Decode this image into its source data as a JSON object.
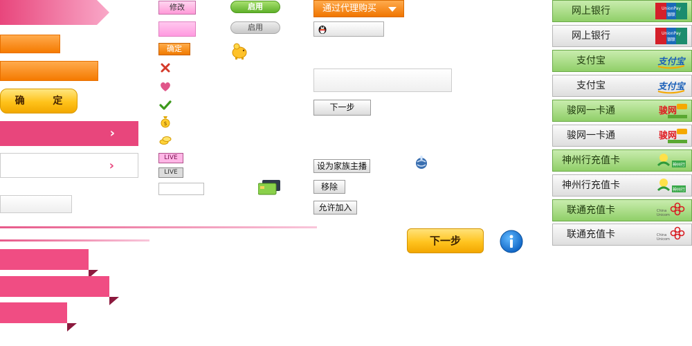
{
  "buttons": {
    "confirm_gold": "确 定",
    "edit_pink": "修改",
    "enable_green": "启用",
    "enable_grey": "启用",
    "confirm_orange": "确定",
    "live_pink": "LIVE",
    "live_grey": "LIVE",
    "agent_buy": "通过代理购买",
    "next_small": "下一步",
    "set_family_host": "设为家族主播",
    "remove": "移除",
    "allow_join": "允许加入",
    "next_gold": "下一步"
  },
  "payment_methods": [
    {
      "label": "网上银行",
      "style": "green",
      "logo": "unionpay-icon",
      "logo_text": "UnionPay 银联"
    },
    {
      "label": "网上银行",
      "style": "grey",
      "logo": "unionpay-icon",
      "logo_text": "UnionPay 银联"
    },
    {
      "label": "支付宝",
      "style": "green",
      "logo": "alipay-icon",
      "logo_text": "支付宝"
    },
    {
      "label": "支付宝",
      "style": "grey",
      "logo": "alipay-icon",
      "logo_text": "支付宝"
    },
    {
      "label": "骏网一卡通",
      "style": "green",
      "logo": "junnet-icon",
      "logo_text": "骏网"
    },
    {
      "label": "骏网一卡通",
      "style": "grey",
      "logo": "junnet-icon",
      "logo_text": "骏网"
    },
    {
      "label": "神州行充值卡",
      "style": "green",
      "logo": "szx-icon",
      "logo_text": "神州行"
    },
    {
      "label": "神州行充值卡",
      "style": "grey",
      "logo": "szx-icon",
      "logo_text": "神州行"
    },
    {
      "label": "联通充值卡",
      "style": "green",
      "logo": "china-unicom-icon",
      "logo_text": "China Unicom"
    },
    {
      "label": "联通充值卡",
      "style": "grey",
      "logo": "china-unicom-icon",
      "logo_text": "China Unicom"
    }
  ],
  "colors": {
    "pink": "#e8467c",
    "orange": "#f57a00",
    "green": "#90cf68",
    "gold": "#ffc41f"
  }
}
